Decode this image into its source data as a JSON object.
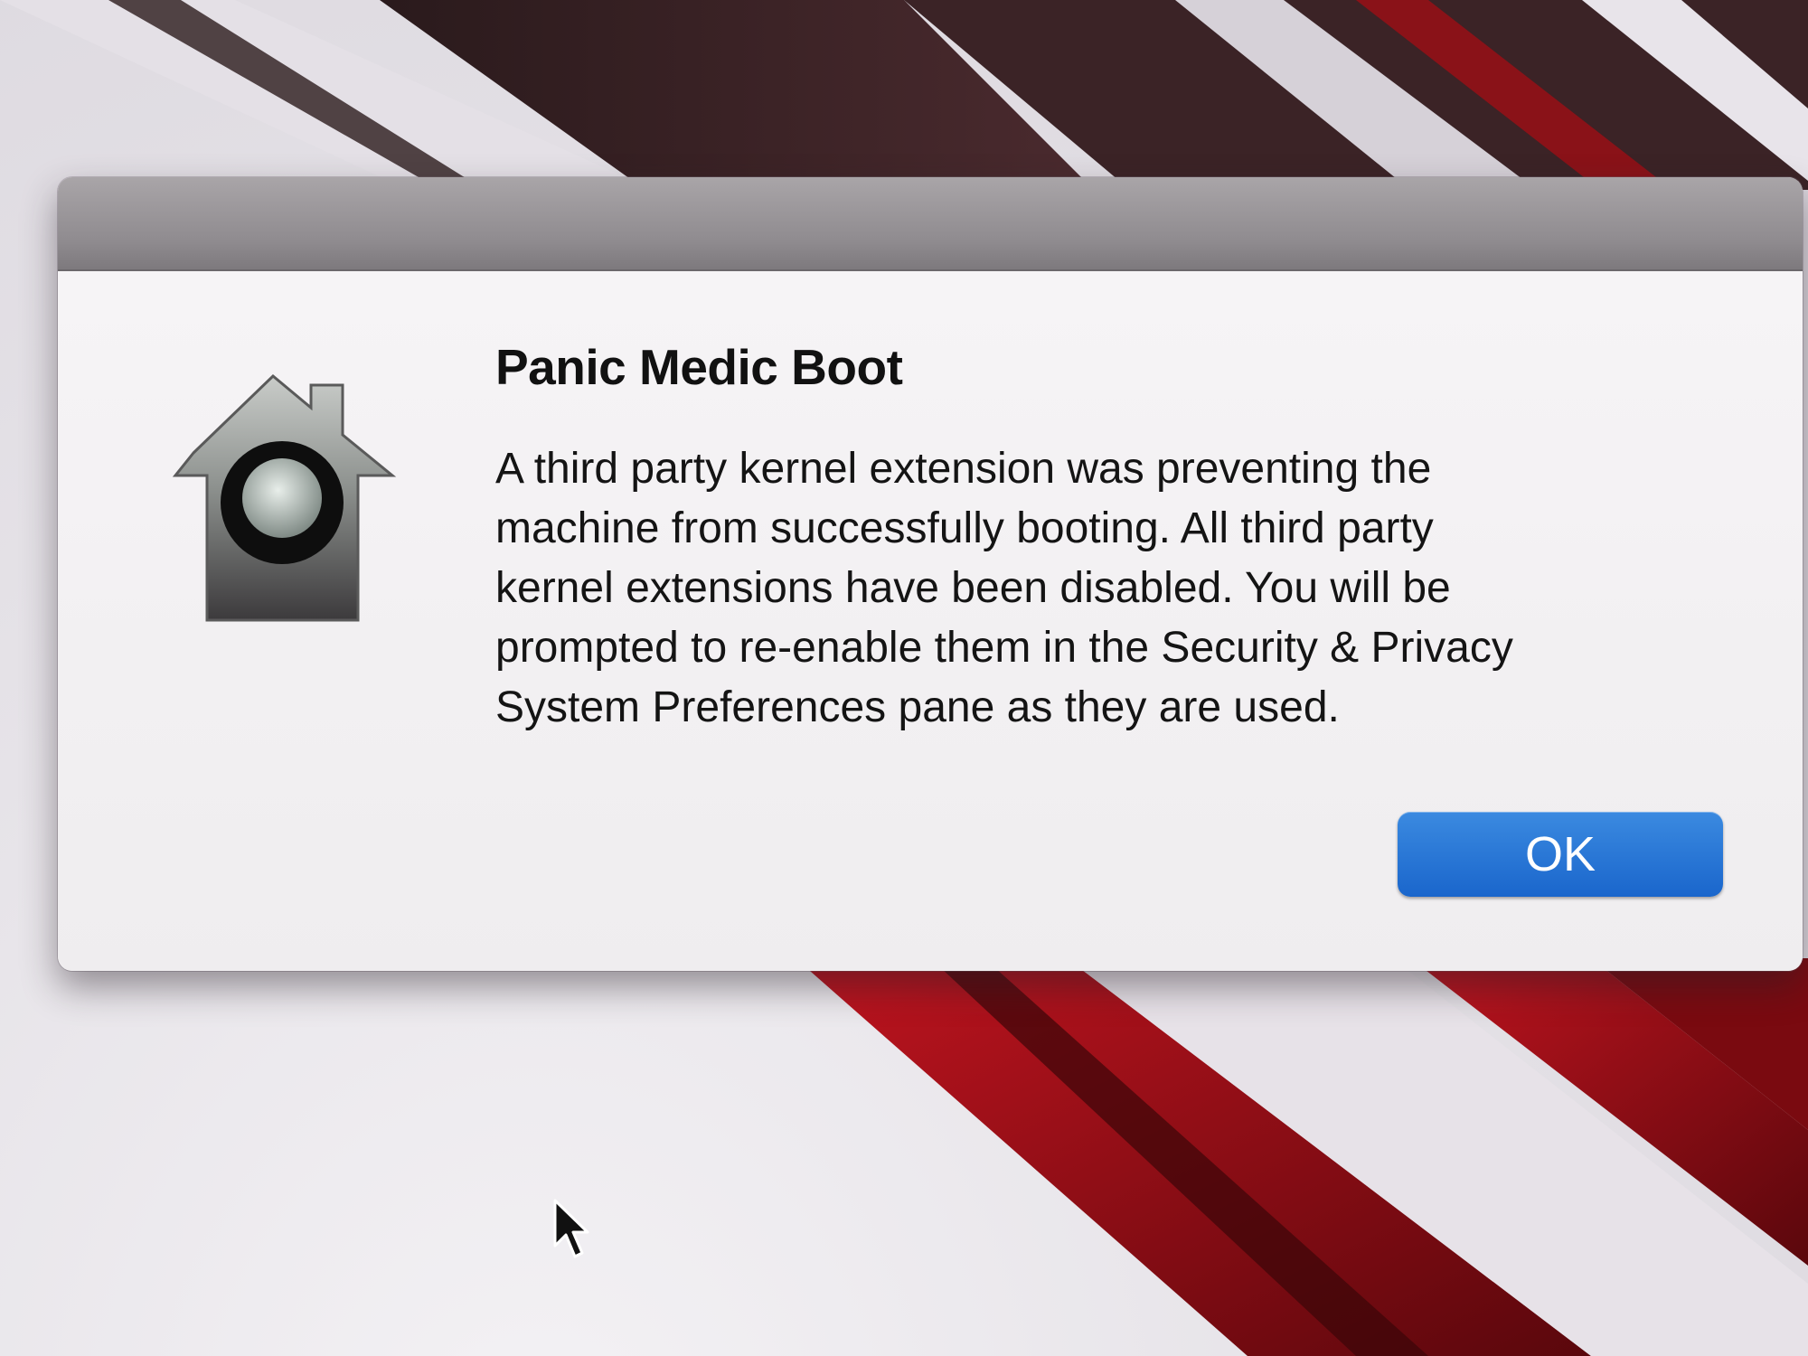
{
  "dialog": {
    "title": "Panic Medic Boot",
    "message": "A third party kernel extension was preventing the\nmachine from successfully booting.  All third party\nkernel extensions have been disabled.  You will be\nprompted to re-enable them in the Security & Privacy\nSystem Preferences pane as they are used.",
    "ok_label": "OK",
    "icon": "security-house-lock-icon"
  },
  "colors": {
    "ok_button": "#1f6fd3",
    "dialog_background": "#f3f1f3",
    "titlebar": "#8f8b8f",
    "wallpaper_accent": "#b0121c"
  },
  "desktop": {
    "cursor": "arrow-cursor-icon"
  }
}
